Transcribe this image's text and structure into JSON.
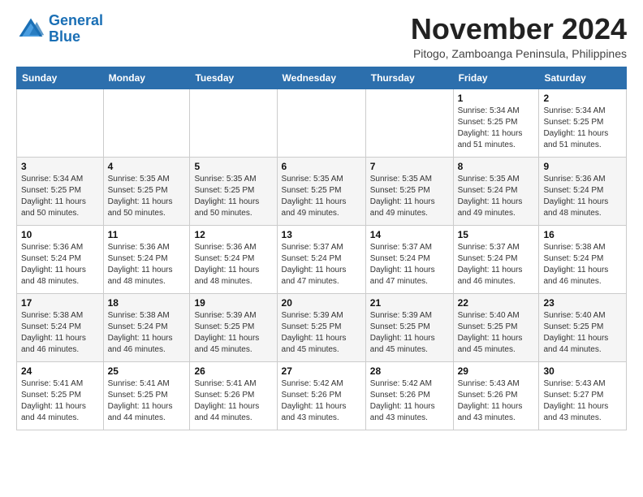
{
  "logo": {
    "name_line1": "General",
    "name_line2": "Blue"
  },
  "header": {
    "month": "November 2024",
    "location": "Pitogo, Zamboanga Peninsula, Philippines"
  },
  "weekdays": [
    "Sunday",
    "Monday",
    "Tuesday",
    "Wednesday",
    "Thursday",
    "Friday",
    "Saturday"
  ],
  "weeks": [
    [
      {
        "day": "",
        "info": ""
      },
      {
        "day": "",
        "info": ""
      },
      {
        "day": "",
        "info": ""
      },
      {
        "day": "",
        "info": ""
      },
      {
        "day": "",
        "info": ""
      },
      {
        "day": "1",
        "info": "Sunrise: 5:34 AM\nSunset: 5:25 PM\nDaylight: 11 hours and 51 minutes."
      },
      {
        "day": "2",
        "info": "Sunrise: 5:34 AM\nSunset: 5:25 PM\nDaylight: 11 hours and 51 minutes."
      }
    ],
    [
      {
        "day": "3",
        "info": "Sunrise: 5:34 AM\nSunset: 5:25 PM\nDaylight: 11 hours and 50 minutes."
      },
      {
        "day": "4",
        "info": "Sunrise: 5:35 AM\nSunset: 5:25 PM\nDaylight: 11 hours and 50 minutes."
      },
      {
        "day": "5",
        "info": "Sunrise: 5:35 AM\nSunset: 5:25 PM\nDaylight: 11 hours and 50 minutes."
      },
      {
        "day": "6",
        "info": "Sunrise: 5:35 AM\nSunset: 5:25 PM\nDaylight: 11 hours and 49 minutes."
      },
      {
        "day": "7",
        "info": "Sunrise: 5:35 AM\nSunset: 5:25 PM\nDaylight: 11 hours and 49 minutes."
      },
      {
        "day": "8",
        "info": "Sunrise: 5:35 AM\nSunset: 5:24 PM\nDaylight: 11 hours and 49 minutes."
      },
      {
        "day": "9",
        "info": "Sunrise: 5:36 AM\nSunset: 5:24 PM\nDaylight: 11 hours and 48 minutes."
      }
    ],
    [
      {
        "day": "10",
        "info": "Sunrise: 5:36 AM\nSunset: 5:24 PM\nDaylight: 11 hours and 48 minutes."
      },
      {
        "day": "11",
        "info": "Sunrise: 5:36 AM\nSunset: 5:24 PM\nDaylight: 11 hours and 48 minutes."
      },
      {
        "day": "12",
        "info": "Sunrise: 5:36 AM\nSunset: 5:24 PM\nDaylight: 11 hours and 48 minutes."
      },
      {
        "day": "13",
        "info": "Sunrise: 5:37 AM\nSunset: 5:24 PM\nDaylight: 11 hours and 47 minutes."
      },
      {
        "day": "14",
        "info": "Sunrise: 5:37 AM\nSunset: 5:24 PM\nDaylight: 11 hours and 47 minutes."
      },
      {
        "day": "15",
        "info": "Sunrise: 5:37 AM\nSunset: 5:24 PM\nDaylight: 11 hours and 46 minutes."
      },
      {
        "day": "16",
        "info": "Sunrise: 5:38 AM\nSunset: 5:24 PM\nDaylight: 11 hours and 46 minutes."
      }
    ],
    [
      {
        "day": "17",
        "info": "Sunrise: 5:38 AM\nSunset: 5:24 PM\nDaylight: 11 hours and 46 minutes."
      },
      {
        "day": "18",
        "info": "Sunrise: 5:38 AM\nSunset: 5:24 PM\nDaylight: 11 hours and 46 minutes."
      },
      {
        "day": "19",
        "info": "Sunrise: 5:39 AM\nSunset: 5:25 PM\nDaylight: 11 hours and 45 minutes."
      },
      {
        "day": "20",
        "info": "Sunrise: 5:39 AM\nSunset: 5:25 PM\nDaylight: 11 hours and 45 minutes."
      },
      {
        "day": "21",
        "info": "Sunrise: 5:39 AM\nSunset: 5:25 PM\nDaylight: 11 hours and 45 minutes."
      },
      {
        "day": "22",
        "info": "Sunrise: 5:40 AM\nSunset: 5:25 PM\nDaylight: 11 hours and 45 minutes."
      },
      {
        "day": "23",
        "info": "Sunrise: 5:40 AM\nSunset: 5:25 PM\nDaylight: 11 hours and 44 minutes."
      }
    ],
    [
      {
        "day": "24",
        "info": "Sunrise: 5:41 AM\nSunset: 5:25 PM\nDaylight: 11 hours and 44 minutes."
      },
      {
        "day": "25",
        "info": "Sunrise: 5:41 AM\nSunset: 5:25 PM\nDaylight: 11 hours and 44 minutes."
      },
      {
        "day": "26",
        "info": "Sunrise: 5:41 AM\nSunset: 5:26 PM\nDaylight: 11 hours and 44 minutes."
      },
      {
        "day": "27",
        "info": "Sunrise: 5:42 AM\nSunset: 5:26 PM\nDaylight: 11 hours and 43 minutes."
      },
      {
        "day": "28",
        "info": "Sunrise: 5:42 AM\nSunset: 5:26 PM\nDaylight: 11 hours and 43 minutes."
      },
      {
        "day": "29",
        "info": "Sunrise: 5:43 AM\nSunset: 5:26 PM\nDaylight: 11 hours and 43 minutes."
      },
      {
        "day": "30",
        "info": "Sunrise: 5:43 AM\nSunset: 5:27 PM\nDaylight: 11 hours and 43 minutes."
      }
    ]
  ]
}
